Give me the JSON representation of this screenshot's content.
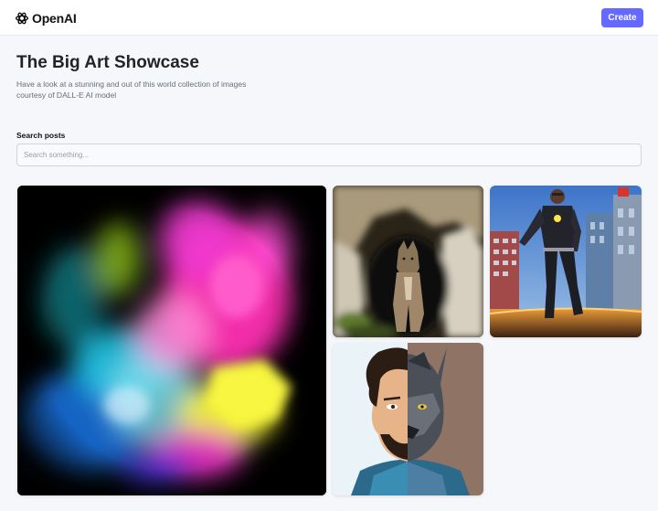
{
  "brand": {
    "name": "OpenAI",
    "icon": "openai-logo-icon"
  },
  "header": {
    "create_label": "Create"
  },
  "page": {
    "title": "The Big Art Showcase",
    "subtitle": "Have a look at a stunning and out of this world collection of images courtesy of DALL-E AI model"
  },
  "search": {
    "label": "Search posts",
    "placeholder": "Search something...",
    "value": ""
  },
  "gallery": {
    "images": [
      {
        "name": "color-powder-explosion-image"
      },
      {
        "name": "wolf-in-cave-image"
      },
      {
        "name": "superhero-in-city-image"
      },
      {
        "name": "half-man-half-wolf-portrait-image"
      }
    ]
  },
  "colors": {
    "accent": "#6469ff",
    "background": "#f6f7fb",
    "title": "#222328",
    "subtitle": "#666e75"
  }
}
